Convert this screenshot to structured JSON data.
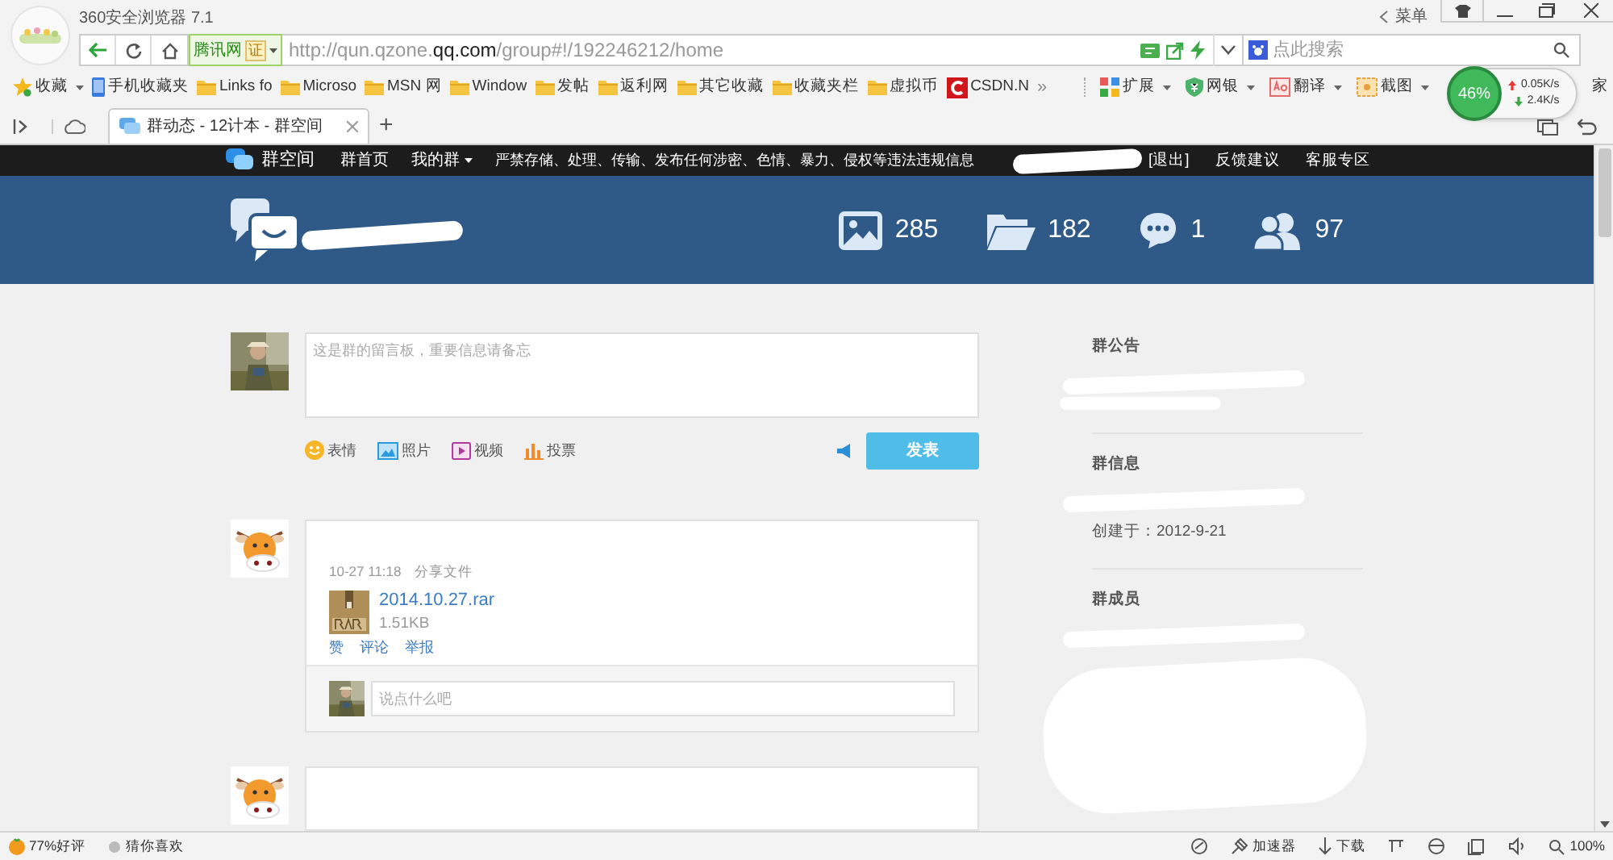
{
  "browser": {
    "title": "360安全浏览器 7.1",
    "menu_label": "菜单",
    "site_name": "腾讯网",
    "cert_badge": "证",
    "url_prefix": "http://qun.qzone.",
    "url_domain": "qq.com",
    "url_path": "/group#!/192246212/home",
    "search_placeholder": "点此搜索"
  },
  "speed_widget": {
    "percent": "46%",
    "upload": "0.05K/s",
    "download": "2.4K/s"
  },
  "bookmarks": [
    {
      "label": "收藏",
      "kind": "star"
    },
    {
      "label": "手机收藏夹",
      "kind": "phone"
    },
    {
      "label": "Links fo",
      "kind": "folder"
    },
    {
      "label": "Microso",
      "kind": "folder"
    },
    {
      "label": "MSN 网",
      "kind": "folder"
    },
    {
      "label": "Window",
      "kind": "folder"
    },
    {
      "label": "发帖",
      "kind": "folder"
    },
    {
      "label": "返利网",
      "kind": "folder"
    },
    {
      "label": "其它收藏",
      "kind": "folder"
    },
    {
      "label": "收藏夹栏",
      "kind": "folder"
    },
    {
      "label": "虚拟币",
      "kind": "folder"
    },
    {
      "label": "CSDN.N",
      "kind": "csdn"
    }
  ],
  "bookmarks_more": "»",
  "tools": [
    {
      "label": "扩展",
      "kind": "extensions"
    },
    {
      "label": "网银",
      "kind": "bank"
    },
    {
      "label": "翻译",
      "kind": "translate"
    },
    {
      "label": "截图",
      "kind": "screenshot"
    }
  ],
  "tools_partial": "家",
  "tabs": [
    {
      "label": "群动态 - 12计本 - 群空间",
      "selected": true
    }
  ],
  "new_tab": "+",
  "site_nav": {
    "brand": "群空间",
    "items": [
      {
        "label": "群首页",
        "dropdown": false
      },
      {
        "label": "我的群",
        "dropdown": true
      }
    ],
    "notice": "严禁存储、处理、传输、发布任何涉密、色情、暴力、侵权等违法违规信息",
    "links": [
      "[退出]",
      "反馈建议",
      "客服专区"
    ]
  },
  "banner": {
    "stats": [
      {
        "kind": "photos",
        "count": "285"
      },
      {
        "kind": "files",
        "count": "182"
      },
      {
        "kind": "messages",
        "count": "1"
      },
      {
        "kind": "members",
        "count": "97"
      }
    ]
  },
  "composer": {
    "placeholder": "这是群的留言板，重要信息请备忘",
    "tools": [
      {
        "kind": "emoji",
        "label": "表情"
      },
      {
        "label": "照片"
      },
      {
        "kind": "video",
        "label": "视频"
      },
      {
        "kind": "poll",
        "label": "投票"
      }
    ],
    "submit": "发表"
  },
  "posts": [
    {
      "cut_off": false,
      "time": "10-27 11:18",
      "action": "分享文件",
      "file_name": "2014.10.27.rar",
      "file_size": "1.51KB",
      "actions": [
        "赞",
        "评论",
        "举报"
      ],
      "comment_placeholder": "说点什么吧"
    },
    {
      "cut_off": true
    }
  ],
  "sidebar": [
    {
      "title": "群公告"
    },
    {
      "title": "群信息",
      "lines": [
        "创建于：2012-9-21"
      ]
    },
    {
      "title": "群成员"
    }
  ],
  "status_bar": {
    "rating": "77%好评",
    "recommend": "猜你喜欢",
    "accelerator": "加速器",
    "download": "下载",
    "zoom": "100%"
  }
}
